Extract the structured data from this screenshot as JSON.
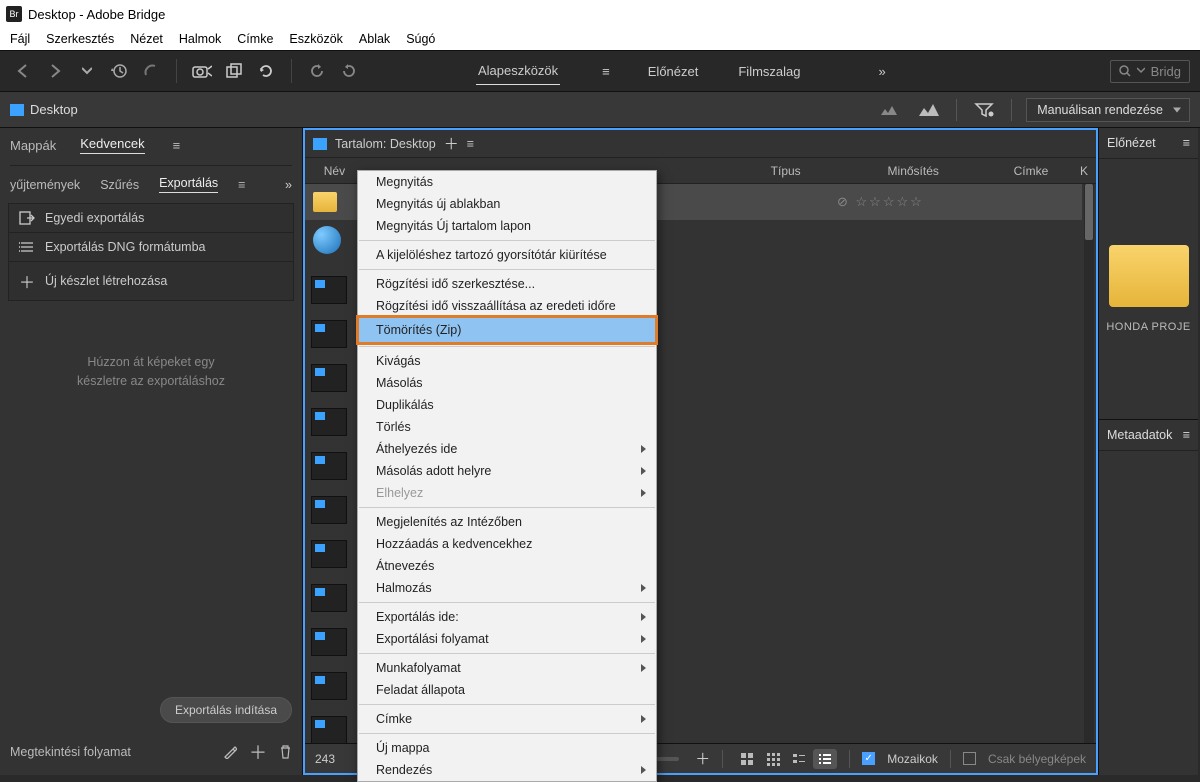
{
  "title": "Desktop - Adobe Bridge",
  "logo_text": "Br",
  "menubar": [
    "Fájl",
    "Szerkesztés",
    "Nézet",
    "Halmok",
    "Címke",
    "Eszközök",
    "Ablak",
    "Súgó"
  ],
  "workspaces": {
    "items": [
      "Alapeszközök",
      "Előnézet",
      "Filmszalag"
    ],
    "active": 0
  },
  "search_placeholder": "Bridg",
  "location": "Desktop",
  "sort_label": "Manuálisan rendezése",
  "left_tabs": {
    "row1": [
      "Mappák",
      "Kedvencek"
    ],
    "row1_active": 1,
    "row2": [
      "yűjtemények",
      "Szűrés",
      "Exportálás"
    ],
    "row2_active": 2
  },
  "export_panel": [
    "Egyedi exportálás",
    "Exportálás DNG formátumba",
    "Új készlet létrehozása"
  ],
  "drop_hint_l1": "Húzzon át képeket egy",
  "drop_hint_l2": "készletre az exportáláshoz",
  "export_button": "Exportálás indítása",
  "bottom_left_label": "Megtekintési folyamat",
  "content_header": "Tartalom: Desktop",
  "columns": {
    "name": "Név",
    "type": "Típus",
    "rating": "Minősítés",
    "label": "Címke",
    "k": "K"
  },
  "item_count": "243",
  "footer": {
    "mozaikok": "Mozaikok",
    "csak": "Csak bélyegképek"
  },
  "right": {
    "preview": "Előnézet",
    "metadata": "Metaadatok",
    "caption": "HONDA PROJE"
  },
  "context_menu": [
    {
      "t": "Megnyitás"
    },
    {
      "t": "Megnyitás új ablakban"
    },
    {
      "t": "Megnyitás Új tartalom lapon"
    },
    {
      "sep": true
    },
    {
      "t": "A kijelöléshez tartozó gyorsítótár kiürítése"
    },
    {
      "sep": true
    },
    {
      "t": "Rögzítési idő szerkesztése..."
    },
    {
      "t": "Rögzítési idő visszaállítása az eredeti időre"
    },
    {
      "t": "Tömörítés (Zip)",
      "hl": true,
      "boxed": true
    },
    {
      "sep": true
    },
    {
      "t": "Kivágás"
    },
    {
      "t": "Másolás"
    },
    {
      "t": "Duplikálás"
    },
    {
      "t": "Törlés"
    },
    {
      "t": "Áthelyezés ide",
      "sub": true
    },
    {
      "t": "Másolás adott helyre",
      "sub": true
    },
    {
      "t": "Elhelyez",
      "sub": true,
      "disabled": true
    },
    {
      "sep": true
    },
    {
      "t": "Megjelenítés az Intézőben"
    },
    {
      "t": "Hozzáadás a kedvencekhez"
    },
    {
      "t": "Átnevezés"
    },
    {
      "t": "Halmozás",
      "sub": true
    },
    {
      "sep": true
    },
    {
      "t": "Exportálás ide:",
      "sub": true
    },
    {
      "t": "Exportálási folyamat",
      "sub": true
    },
    {
      "sep": true
    },
    {
      "t": "Munkafolyamat",
      "sub": true
    },
    {
      "t": "Feladat állapota"
    },
    {
      "sep": true
    },
    {
      "t": "Címke",
      "sub": true
    },
    {
      "sep": true
    },
    {
      "t": "Új mappa"
    },
    {
      "t": "Rendezés",
      "sub": true
    }
  ]
}
